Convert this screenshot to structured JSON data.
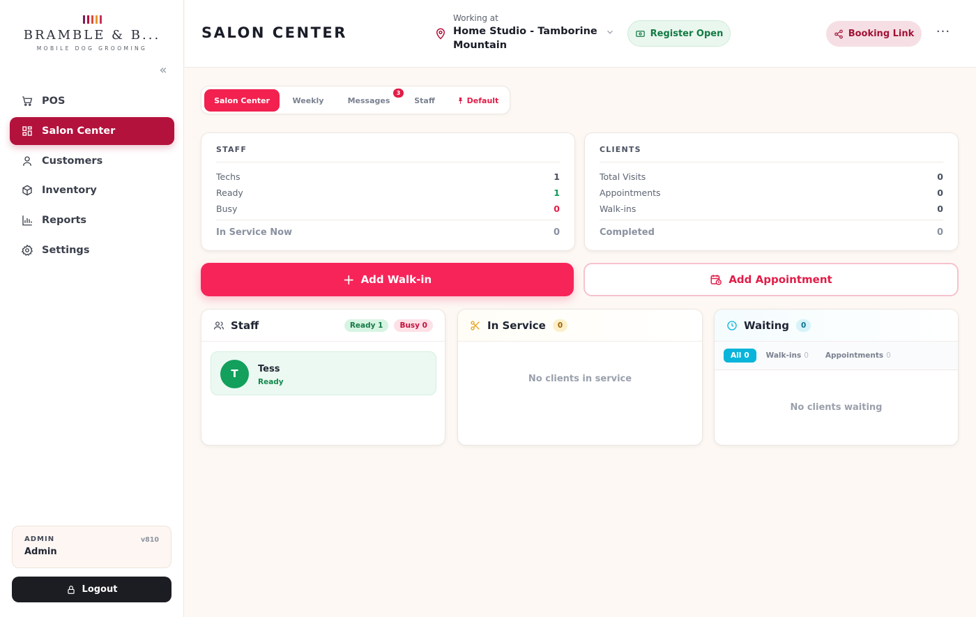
{
  "brand": {
    "name": "BRAMBLE & B...",
    "tagline": "MOBILE DOG GROOMING",
    "bar_colors": [
      "#7c1d5c",
      "#b3123c",
      "#e04a3b",
      "#e59a2b",
      "#c8325a"
    ]
  },
  "sidebar": {
    "items": [
      {
        "label": "POS",
        "icon": "cart-icon",
        "active": false
      },
      {
        "label": "Salon Center",
        "icon": "grid-icon",
        "active": true
      },
      {
        "label": "Customers",
        "icon": "user-icon",
        "active": false
      },
      {
        "label": "Inventory",
        "icon": "box-icon",
        "active": false
      },
      {
        "label": "Reports",
        "icon": "bar-chart-icon",
        "active": false
      },
      {
        "label": "Settings",
        "icon": "gear-icon",
        "active": false
      }
    ],
    "user": {
      "role": "ADMIN",
      "version": "v810",
      "name": "Admin"
    },
    "logout_label": "Logout"
  },
  "header": {
    "title": "SALON CENTER",
    "location_label": "Working at",
    "location_name": "Home Studio - Tamborine Mountain",
    "register_label": "Register Open",
    "booking_label": "Booking Link",
    "more_label": "···"
  },
  "tabs": [
    {
      "label": "Salon Center",
      "active": true
    },
    {
      "label": "Weekly"
    },
    {
      "label": "Messages",
      "badge": "3"
    },
    {
      "label": "Staff"
    },
    {
      "label": "Default",
      "icon": "pin-icon"
    }
  ],
  "staff_stats": {
    "title": "STAFF",
    "rows": [
      {
        "label": "Techs",
        "value": "1"
      },
      {
        "label": "Ready",
        "value": "1"
      },
      {
        "label": "Busy",
        "value": "0"
      }
    ],
    "footer": {
      "label": "In Service Now",
      "value": "0"
    }
  },
  "client_stats": {
    "title": "CLIENTS",
    "rows": [
      {
        "label": "Total Visits",
        "value": "0"
      },
      {
        "label": "Appointments",
        "value": "0"
      },
      {
        "label": "Walk-ins",
        "value": "0"
      }
    ],
    "footer": {
      "label": "Completed",
      "value": "0"
    }
  },
  "actions": {
    "walkin_label": "Add Walk-in",
    "appointment_label": "Add Appointment"
  },
  "staff_panel": {
    "title": "Staff",
    "ready_badge": "Ready 1",
    "busy_badge": "Busy 0",
    "members": [
      {
        "initial": "T",
        "name": "Tess",
        "status": "Ready"
      }
    ]
  },
  "service_panel": {
    "title": "In Service",
    "count": "0",
    "empty": "No clients in service"
  },
  "waiting_panel": {
    "title": "Waiting",
    "count": "0",
    "tabs": [
      {
        "label": "All",
        "count": "0",
        "active": true
      },
      {
        "label": "Walk-ins",
        "count": "0"
      },
      {
        "label": "Appointments",
        "count": "0"
      }
    ],
    "empty": "No clients waiting"
  }
}
